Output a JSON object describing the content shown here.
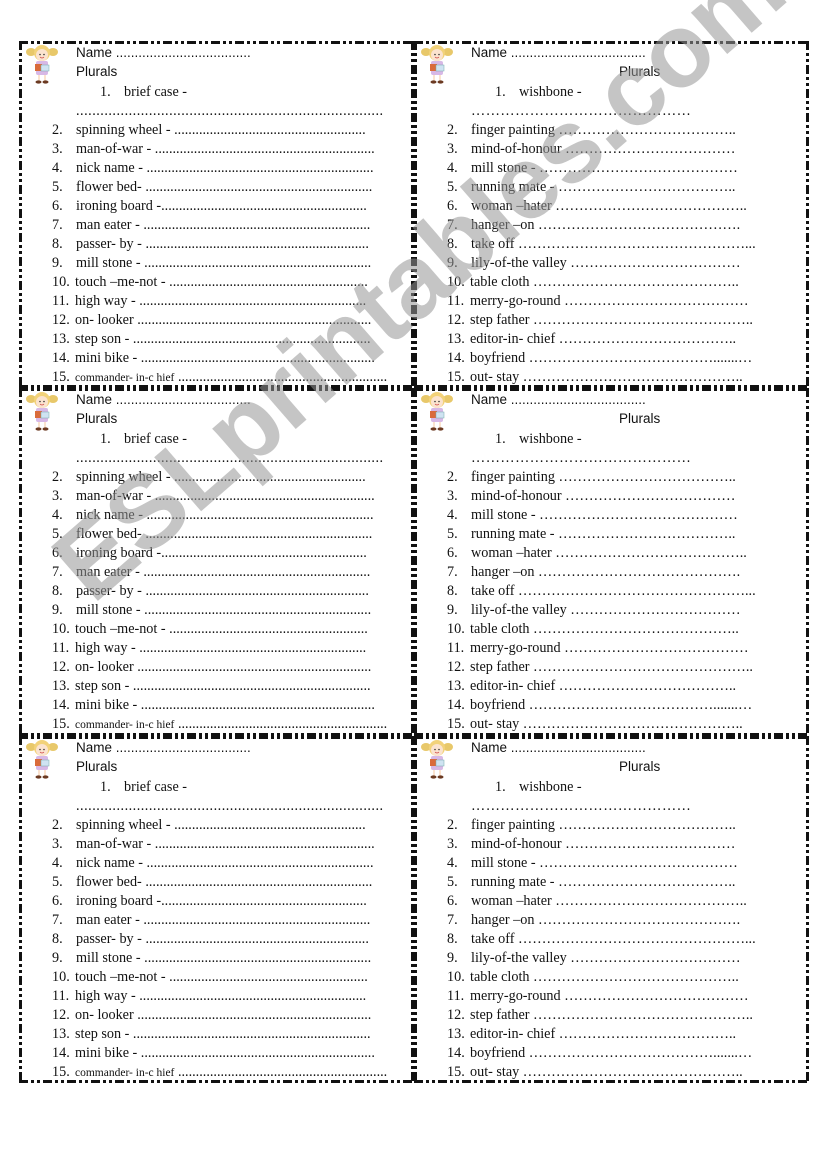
{
  "watermark": "ESLprintables.com",
  "cards": {
    "left": {
      "name_label": "Name ....................................",
      "title": "Plurals",
      "items": [
        {
          "num": "1.",
          "text": "brief case -"
        },
        {
          "num": "",
          "text": "............................................................................"
        },
        {
          "num": "2.",
          "text": "spinning wheel - ......................................................"
        },
        {
          "num": "3.",
          "text": "man-of-war - .............................................................."
        },
        {
          "num": "4.",
          "text": "nick name - ................................................................"
        },
        {
          "num": "5.",
          "text": "flower bed- ................................................................"
        },
        {
          "num": "6.",
          "text": "ironing board -.........................................................."
        },
        {
          "num": "7.",
          "text": "man eater - ................................................................"
        },
        {
          "num": "8.",
          "text": "passer- by - ..............................................................."
        },
        {
          "num": "9.",
          "text": "mill stone - ................................................................"
        },
        {
          "num": "10.",
          "text": "touch –me-not - ........................................................"
        },
        {
          "num": "11.",
          "text": "high way - ................................................................"
        },
        {
          "num": "12.",
          "text": "on- looker .................................................................."
        },
        {
          "num": "13.",
          "text": "step son - ..................................................................."
        },
        {
          "num": "14.",
          "text": "mini bike - .................................................................."
        },
        {
          "num": "15.",
          "text": "commander- in-c hief",
          "dots": " ..........................................................."
        }
      ]
    },
    "right": {
      "name_label": "Name ....................................",
      "title": "Plurals",
      "items": [
        {
          "num": "1.",
          "text": "wishbone  -"
        },
        {
          "num": "",
          "text": "………………………………………"
        },
        {
          "num": "2.",
          "text": "finger painting ……………………………….."
        },
        {
          "num": "3.",
          "text": "mind-of-honour ………………………………"
        },
        {
          "num": "4.",
          "text": "mill stone - ……………………………………"
        },
        {
          "num": "5.",
          "text": "running mate - ……………………………….."
        },
        {
          "num": "6.",
          "text": "woman –hater ………………………………….."
        },
        {
          "num": "7.",
          "text": "hanger –on  ……………………………………."
        },
        {
          "num": "8.",
          "text": "take off  …………………………………………..."
        },
        {
          "num": "9.",
          "text": "lily-of-the valley ………………………………"
        },
        {
          "num": "10.",
          "text": "table cloth …………………………………….."
        },
        {
          "num": "11.",
          "text": "merry-go-round …………………………………"
        },
        {
          "num": "12.",
          "text": "step father ……………………………………….."
        },
        {
          "num": "13.",
          "text": "editor-in- chief ……………………………….."
        },
        {
          "num": "14.",
          "text": "boyfriend ………………………………….......…"
        },
        {
          "num": "15.",
          "text": "out- stay ……………………………………….."
        }
      ]
    }
  },
  "rows": 3
}
